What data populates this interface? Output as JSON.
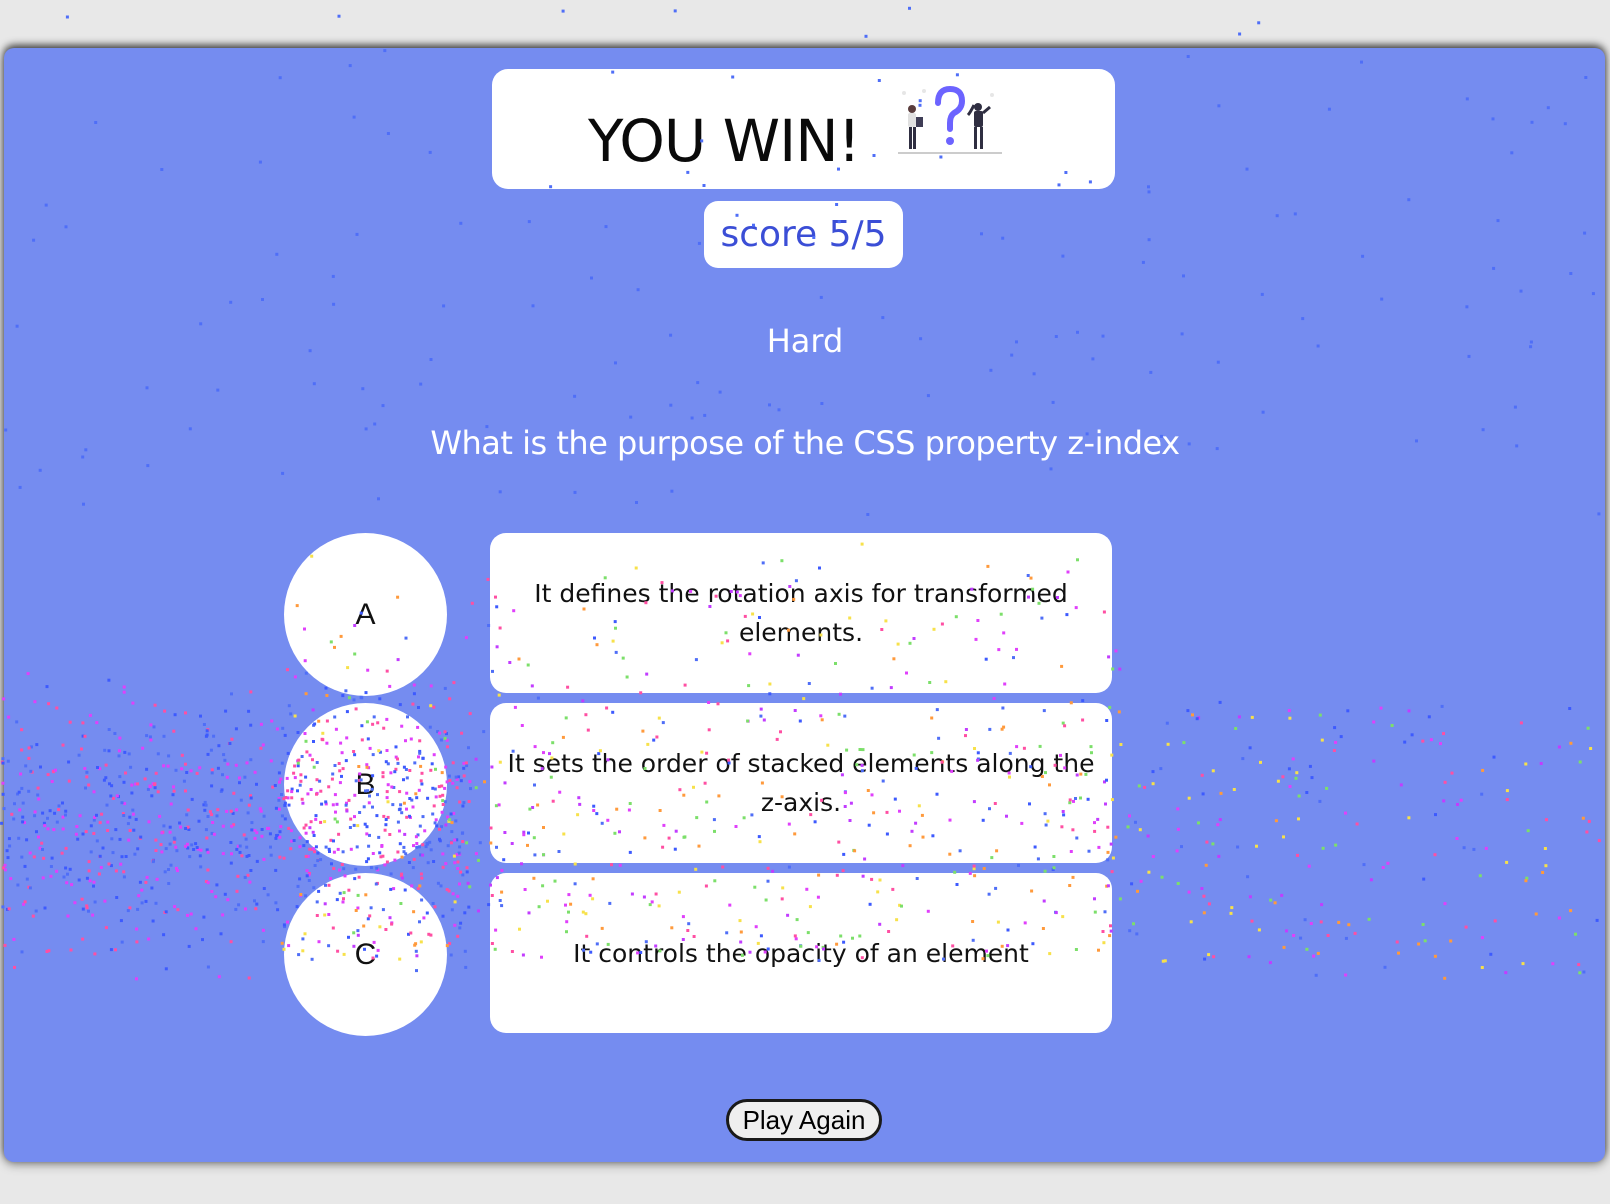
{
  "header": {
    "title": "YOU WIN!",
    "illustration_icon": "question-mark-people-illustration"
  },
  "score": {
    "text": "score 5/5",
    "value": 5,
    "max": 5
  },
  "quiz": {
    "difficulty": "Hard",
    "question": "What is the purpose of the CSS property z-index",
    "answers": [
      {
        "letter": "A",
        "text": "It defines the rotation axis for transformed elements."
      },
      {
        "letter": "B",
        "text": "It sets the order of stacked elements along the z-axis."
      },
      {
        "letter": "C",
        "text": "It controls the opacity of an element"
      }
    ]
  },
  "actions": {
    "play_again_label": "Play Again"
  },
  "colors": {
    "page_background": "#e8e8e8",
    "stage_background": "#758cf0",
    "card_background": "#ffffff",
    "score_text": "#3b4ed6",
    "illustration_accent": "#6c63ff",
    "confetti": [
      "#4f6ef7",
      "#e040fb",
      "#ff4fa3",
      "#3d5afe",
      "#f7e14a",
      "#ff9a3c",
      "#7cdf6a",
      "#c23cff"
    ]
  }
}
